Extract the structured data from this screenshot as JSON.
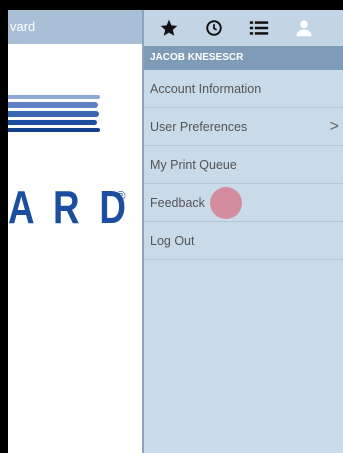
{
  "background_app": {
    "header_text": "vard",
    "logo_text": "A R D",
    "logo_registered": "®"
  },
  "toolbar": {
    "icons": [
      "star-icon",
      "clock-icon",
      "list-icon",
      "user-icon"
    ]
  },
  "user": {
    "name": "JACOB KNESESCR"
  },
  "menu": {
    "items": [
      {
        "label": "Account Information"
      },
      {
        "label": "User Preferences",
        "chevron": ">"
      },
      {
        "label": "My Print Queue"
      },
      {
        "label": "Feedback"
      },
      {
        "label": "Log Out"
      }
    ]
  },
  "colors": {
    "header_blue": "#a8bfd6",
    "menu_bg": "#c9dae8",
    "user_bar": "#7e9cb8",
    "logo_blue": "#1b4e9f",
    "cursor": "#dc5a6e"
  }
}
